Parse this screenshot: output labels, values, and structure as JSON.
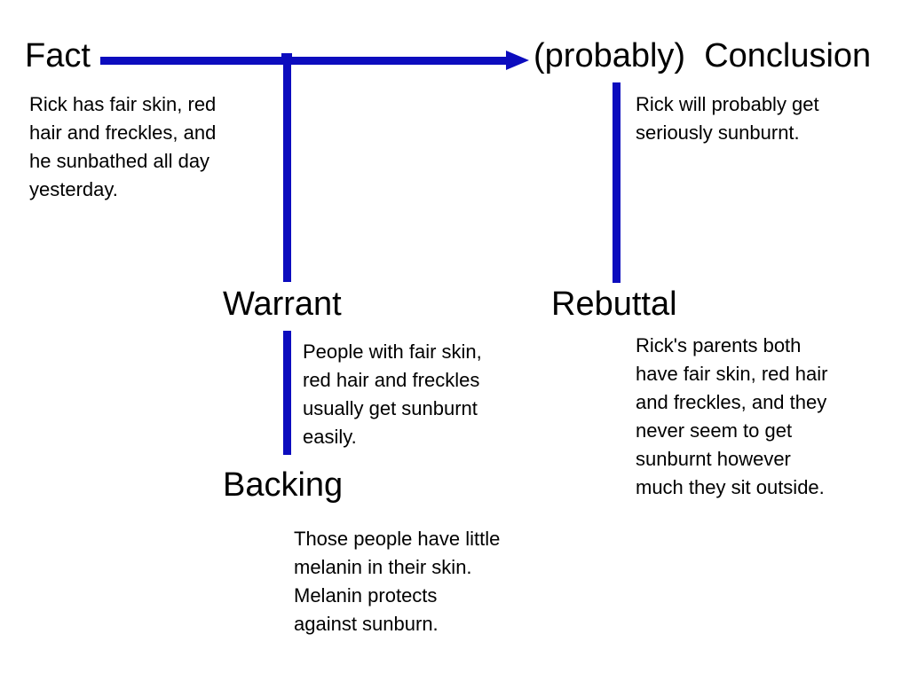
{
  "diagram": {
    "type": "toulmin-argument-model",
    "accent_color": "#0C0CBE",
    "text_color": "#000000",
    "background_color": "#FFFFFF",
    "nodes": {
      "fact": {
        "heading": "Fact",
        "body": "Rick has fair skin, red\nhair and freckles, and\nhe sunbathed all day\nyesterday."
      },
      "conclusion": {
        "qualifier": "(probably)",
        "heading": "(probably)  Conclusion",
        "body": "Rick will probably get\nseriously sunburnt."
      },
      "warrant": {
        "heading": "Warrant",
        "body": "People with fair skin,\nred hair and freckles\nusually get sunburnt\neasily."
      },
      "backing": {
        "heading": "Backing",
        "body": "Those people have little\nmelanin in their skin.\nMelanin protects\nagainst sunburn."
      },
      "rebuttal": {
        "heading": "Rebuttal",
        "body": "Rick's parents both\nhave fair skin, red hair\nand freckles, and they\nnever seem to get\nsunburnt however\nmuch they sit outside."
      }
    },
    "connectors": [
      {
        "name": "fact-to-conclusion-arrow",
        "from": "fact",
        "to": "conclusion",
        "style": "arrow-right"
      },
      {
        "name": "warrant-support-line",
        "from": "warrant",
        "to": "fact-to-conclusion-arrow",
        "style": "line-vertical"
      },
      {
        "name": "backing-support-line",
        "from": "backing",
        "to": "warrant",
        "style": "line-vertical"
      },
      {
        "name": "rebuttal-support-line",
        "from": "rebuttal",
        "to": "conclusion",
        "style": "line-vertical"
      }
    ]
  }
}
